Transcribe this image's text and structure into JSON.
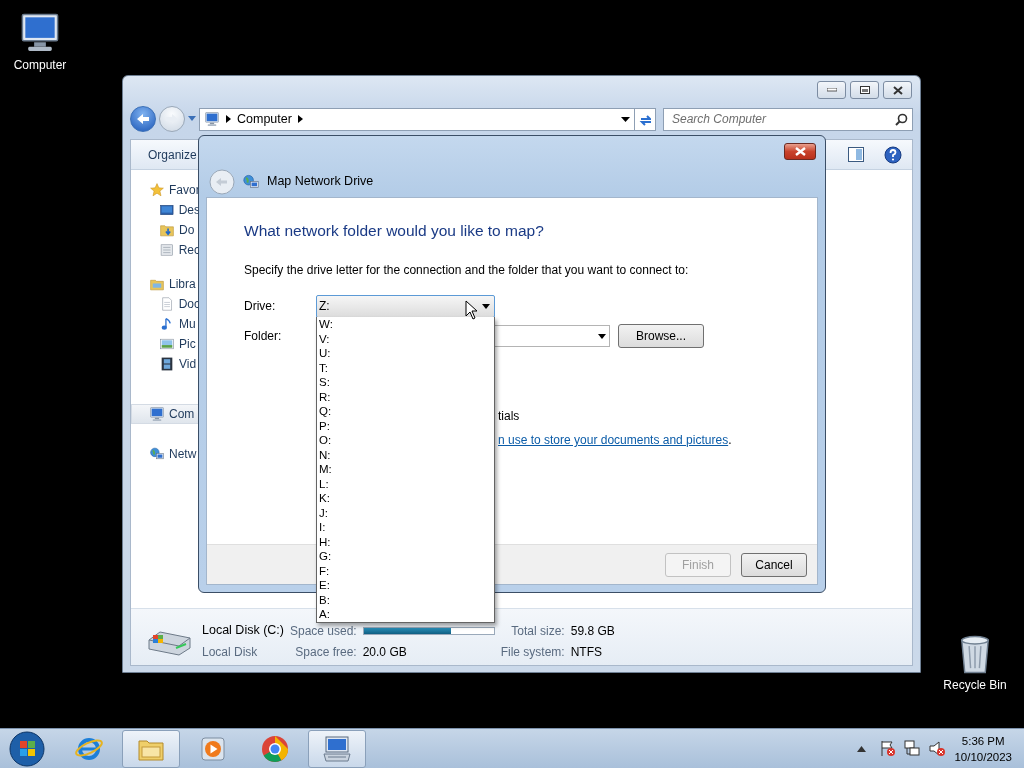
{
  "desktop_icons": [
    {
      "label": "Computer",
      "kind": "computer"
    },
    {
      "label": "Recycle Bin",
      "kind": "recycle"
    }
  ],
  "explorer": {
    "address": {
      "crumbs": [
        "Computer"
      ]
    },
    "search": {
      "placeholder": "Search Computer"
    },
    "toolbar": {
      "buttons": [
        "Organize"
      ]
    },
    "sidebar": {
      "items": [
        {
          "label": "Favor",
          "kind": "star",
          "selected": false,
          "children": [
            {
              "label": "Des",
              "kind": "desktop",
              "selected": false
            },
            {
              "label": "Do",
              "kind": "downloads",
              "selected": false
            },
            {
              "label": "Rec",
              "kind": "recent",
              "selected": false
            }
          ]
        },
        {
          "label": "Libra",
          "kind": "library",
          "selected": false,
          "children": [
            {
              "label": "Doc",
              "kind": "document",
              "selected": false
            },
            {
              "label": "Mu",
              "kind": "music",
              "selected": false
            },
            {
              "label": "Pic",
              "kind": "picture",
              "selected": false
            },
            {
              "label": "Vid",
              "kind": "video",
              "selected": false
            }
          ]
        },
        {
          "label": "Com",
          "kind": "computer",
          "selected": true
        },
        {
          "label": "Netw",
          "kind": "network",
          "selected": false
        }
      ]
    },
    "details": {
      "name": "Local Disk (C:)",
      "type": "Local Disk",
      "space_used_label": "Space used:",
      "level": 0.67,
      "space_free_label": "Space free:",
      "space_free": "20.0 GB",
      "total_size_label": "Total size:",
      "total_size": "59.8 GB",
      "file_system_label": "File system:",
      "file_system": "NTFS"
    }
  },
  "dialog": {
    "title": "Map Network Drive",
    "heading": "What network folder would you like to map?",
    "instruction": "Specify the drive letter for the connection and the folder that you want to connect to:",
    "drive": {
      "label": "Drive:",
      "value": "Z:",
      "expanded": true,
      "options": [
        {
          "label": "W:",
          "selected": false
        },
        {
          "label": "V:",
          "selected": false
        },
        {
          "label": "U:",
          "selected": false
        },
        {
          "label": "T:",
          "selected": false
        },
        {
          "label": "S:",
          "selected": false
        },
        {
          "label": "R:",
          "selected": false
        },
        {
          "label": "Q:",
          "selected": false
        },
        {
          "label": "P:",
          "selected": false
        },
        {
          "label": "O:",
          "selected": false
        },
        {
          "label": "N:",
          "selected": false
        },
        {
          "label": "M:",
          "selected": false
        },
        {
          "label": "L:",
          "selected": false
        },
        {
          "label": "K:",
          "selected": false
        },
        {
          "label": "J:",
          "selected": false
        },
        {
          "label": "I:",
          "selected": false
        },
        {
          "label": "H:",
          "selected": false
        },
        {
          "label": "G:",
          "selected": false
        },
        {
          "label": "F:",
          "selected": false
        },
        {
          "label": "E:",
          "selected": false
        },
        {
          "label": "B:",
          "selected": false
        },
        {
          "label": "A:",
          "selected": false
        }
      ]
    },
    "folder": {
      "label": "Folder:"
    },
    "browse": "Browse...",
    "option_text": "tials",
    "link": "n use to store your documents and pictures",
    "link_suffix": ".",
    "buttons": [
      {
        "label": "Finish",
        "disabled": true
      },
      {
        "label": "Cancel",
        "disabled": false
      }
    ]
  },
  "taskbar": {
    "apps": [
      {
        "kind": "browser-e",
        "selected": false
      },
      {
        "kind": "folder",
        "selected": true
      },
      {
        "kind": "media",
        "selected": false
      },
      {
        "kind": "chrome",
        "selected": false
      },
      {
        "kind": "remote",
        "selected": true
      }
    ],
    "clock": {
      "time": "5:36 PM",
      "date": "10/10/2023"
    }
  }
}
